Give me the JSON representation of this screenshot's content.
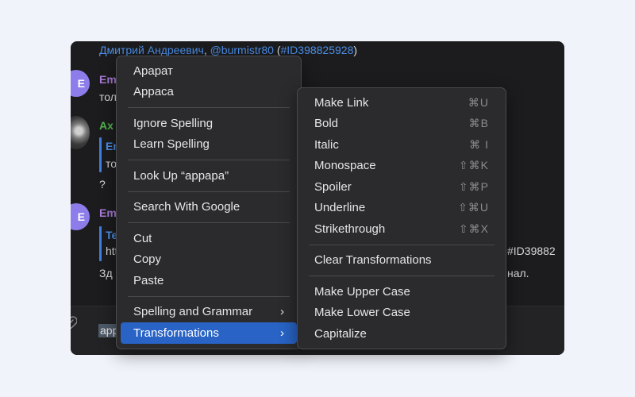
{
  "chat": {
    "header_name": "Дмитрий Андреевич",
    "header_sep": ",",
    "header_handle": "@burmistr80",
    "header_id_open": "(",
    "header_id": "#ID398825928",
    "header_id_close": ")",
    "msg1_name": "Em",
    "msg1_text": "тол",
    "msg2_name": "Ах",
    "msg2_quote_name": "Em",
    "msg2_quote_text": "то",
    "msg2_text": "?",
    "msg3_name": "Em",
    "msg3_quote_name": "Te",
    "msg3_quote_text": "htt",
    "msg3_text_left": "Зд",
    "msg3_right_id": "#ID39882",
    "msg3_right_text": "нал.",
    "composer_word": "app",
    "avatar_letter": "E"
  },
  "context_menu": {
    "items": [
      {
        "label": "Арарат"
      },
      {
        "label": "Appaca"
      },
      {
        "label": "Ignore Spelling"
      },
      {
        "label": "Learn Spelling"
      },
      {
        "label": "Look Up “appapa”"
      },
      {
        "label": "Search With Google"
      },
      {
        "label": "Cut"
      },
      {
        "label": "Copy"
      },
      {
        "label": "Paste"
      },
      {
        "label": "Spelling and Grammar",
        "arrow": "›"
      },
      {
        "label": "Transformations",
        "arrow": "›"
      }
    ]
  },
  "transformations_menu": {
    "items": [
      {
        "label": "Make Link",
        "shortcut": "⌘U"
      },
      {
        "label": "Bold",
        "shortcut": "⌘B"
      },
      {
        "label": "Italic",
        "shortcut": "⌘ I"
      },
      {
        "label": "Monospace",
        "shortcut": "⇧⌘K"
      },
      {
        "label": "Spoiler",
        "shortcut": "⇧⌘P"
      },
      {
        "label": "Underline",
        "shortcut": "⇧⌘U"
      },
      {
        "label": "Strikethrough",
        "shortcut": "⇧⌘X"
      },
      {
        "label": "Clear Transformations"
      },
      {
        "label": "Make Upper Case"
      },
      {
        "label": "Make Lower Case"
      },
      {
        "label": "Capitalize"
      }
    ]
  },
  "colors": {
    "accent": "#2863c5",
    "link": "#4c90ea",
    "menu_bg": "#2b2b2d",
    "window_bg": "#1c1c1e"
  }
}
